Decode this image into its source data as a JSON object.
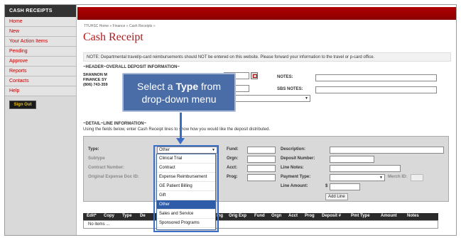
{
  "sidebar": {
    "title": "CASH RECEIPTS",
    "items": [
      {
        "label": "Home"
      },
      {
        "label": "New"
      },
      {
        "label": "Your Action Items"
      },
      {
        "label": "Pending"
      },
      {
        "label": "Approve"
      },
      {
        "label": "Reports"
      },
      {
        "label": "Contacts"
      },
      {
        "label": "Help"
      }
    ],
    "signout_label": "Sign Out"
  },
  "breadcrumb": "TTUHSC Home  »  Finance  »  Cash Receipts  »",
  "page_title": "Cash Receipt",
  "note": "NOTE: Departmental travel/p-card reimbursements should NOT be entered on this website. Please forward your information to the travel or p-card office.",
  "header_section": {
    "label": "~HEADER~OVERALL DEPOSIT INFORMATION~",
    "name_line1": "SHANNON M",
    "name_line2": "FINANCE SY",
    "phone": "(806) 743-359",
    "notes_label": "NOTES:",
    "sbs_notes_label": "SBS NOTES:"
  },
  "callout": {
    "prefix": "Select a ",
    "bold": "Type",
    "suffix": " from",
    "line2": "drop-down menu"
  },
  "detail_section": {
    "label": "~DETAIL~LINE INFORMATION~",
    "instructions": "Using the fields below, enter Cash Receipt lines to show how you would like the deposit distributed.",
    "type_label": "Type:",
    "type_value": "Other",
    "subtype_label": "Subtype",
    "contract_label": "Contract Number:",
    "orig_expense_label": "Original Expense Doc ID:",
    "fund_label": "Fund:",
    "orgn_label": "Orgn:",
    "acct_label": "Acct:",
    "prog_label": "Prog:",
    "description_label": "Description:",
    "deposit_number_label": "Deposit Number:",
    "line_notes_label": "Line Notes:",
    "payment_type_label": "Payment Type:",
    "merch_id_label": "Merch ID:",
    "line_amount_label": "Line Amount:",
    "currency": "$",
    "add_line_label": "Add Line"
  },
  "dropdown_options": [
    {
      "label": "Clinical Trial",
      "selected": false
    },
    {
      "label": "Contract",
      "selected": false
    },
    {
      "label": "Expense Reimbursement",
      "selected": false
    },
    {
      "label": "GE Patient Billing",
      "selected": false
    },
    {
      "label": "Gift",
      "selected": false
    },
    {
      "label": "Other",
      "selected": true
    },
    {
      "label": "Sales and Service",
      "selected": false
    },
    {
      "label": "Sponsored Programs",
      "selected": false
    }
  ],
  "table": {
    "headers": [
      "Edit*",
      "Copy",
      "Type",
      "De",
      "ing",
      "Orig Exp",
      "Fund",
      "Orgn",
      "Acct",
      "Prog",
      "Deposit #",
      "Pmt Type",
      "Amount",
      "Notes"
    ],
    "empty_text": "No items ..."
  }
}
